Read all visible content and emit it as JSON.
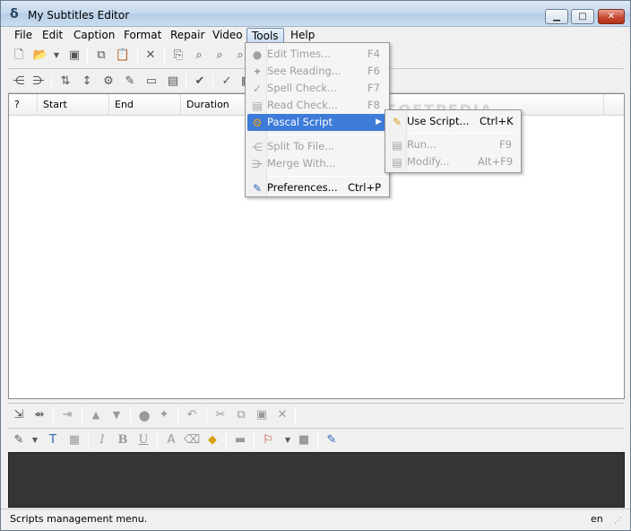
{
  "window": {
    "title": "My Subtitles Editor",
    "app_icon": "app-logo-icon"
  },
  "window_buttons": {
    "minimize": "▁",
    "maximize": "□",
    "close": "✕"
  },
  "menubar": {
    "items": [
      "File",
      "Edit",
      "Caption",
      "Format",
      "Repair",
      "Video",
      "Tools",
      "Help"
    ],
    "active": "Tools"
  },
  "grid": {
    "columns": [
      "?",
      "Start",
      "End",
      "Duration"
    ]
  },
  "tools_menu": {
    "items": [
      {
        "label": "Edit Times...",
        "shortcut": "F4",
        "icon": "clock-icon",
        "enabled": false
      },
      {
        "label": "See Reading...",
        "shortcut": "F6",
        "icon": "reading-icon",
        "enabled": false
      },
      {
        "label": "Spell Check...",
        "shortcut": "F7",
        "icon": "spellcheck-icon",
        "enabled": false
      },
      {
        "label": "Read Check...",
        "shortcut": "F8",
        "icon": "read-check-icon",
        "enabled": false
      },
      {
        "label": "Pascal Script",
        "shortcut": "",
        "icon": "gear-script-icon",
        "enabled": true,
        "highlighted": true,
        "submenu": true
      },
      {
        "label": "Split To File...",
        "shortcut": "",
        "icon": "split-icon",
        "enabled": false
      },
      {
        "label": "Merge With...",
        "shortcut": "",
        "icon": "merge-icon",
        "enabled": false
      },
      {
        "label": "Preferences...",
        "shortcut": "Ctrl+P",
        "icon": "preferences-icon",
        "enabled": true
      }
    ]
  },
  "pascal_submenu": {
    "items": [
      {
        "label": "Use Script...",
        "shortcut": "Ctrl+K",
        "icon": "script-edit-icon",
        "enabled": true
      },
      {
        "label": "Run...",
        "shortcut": "F9",
        "icon": "run-icon",
        "enabled": false
      },
      {
        "label": "Modify...",
        "shortcut": "Alt+F9",
        "icon": "modify-icon",
        "enabled": false
      }
    ]
  },
  "statusbar": {
    "message": "Scripts management menu.",
    "language": "en"
  },
  "watermark": "SOFTPEDIA"
}
